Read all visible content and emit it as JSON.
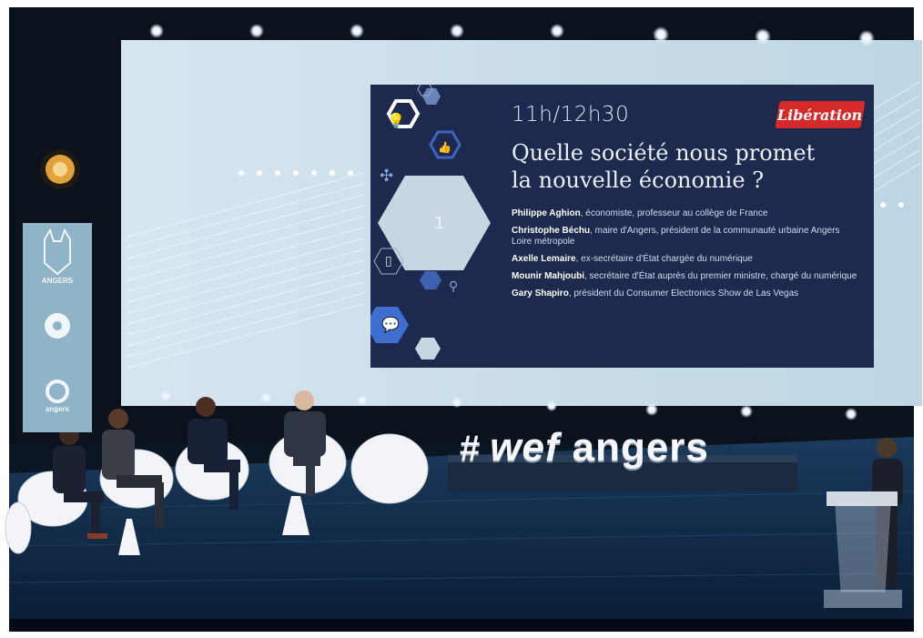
{
  "slide": {
    "time": "11h/12h30",
    "title_line1": "Quelle société nous promet",
    "title_line2": "la nouvelle économie ?",
    "hex_number": "1",
    "logo": "Libération",
    "speakers": [
      {
        "name": "Philippe Aghion",
        "role": ", économiste, professeur au collège de France"
      },
      {
        "name": "Christophe Béchu",
        "role": ", maire d'Angers, président de la communauté urbaine Angers Loire métropole"
      },
      {
        "name": "Axelle Lemaire",
        "role": ", ex-secrétaire d'État chargée du numérique"
      },
      {
        "name": "Mounir Mahjoubi",
        "role": ", secrétaire d'État auprès du premier ministre, chargé du numérique"
      },
      {
        "name": "Gary Shapiro",
        "role": ", président du Consumer Electronics Show de Las Vegas"
      }
    ]
  },
  "banner": {
    "line1": "ANGERS",
    "line2": "",
    "line3": "angers"
  },
  "stage_sign": {
    "hash": "#",
    "wef": "wef",
    "city": "angers"
  },
  "colors": {
    "screen": "#c9dde9",
    "slide_bg": "#1d2a4d",
    "stage_floor": "#0f2540",
    "logo_red": "#d62a2a"
  }
}
